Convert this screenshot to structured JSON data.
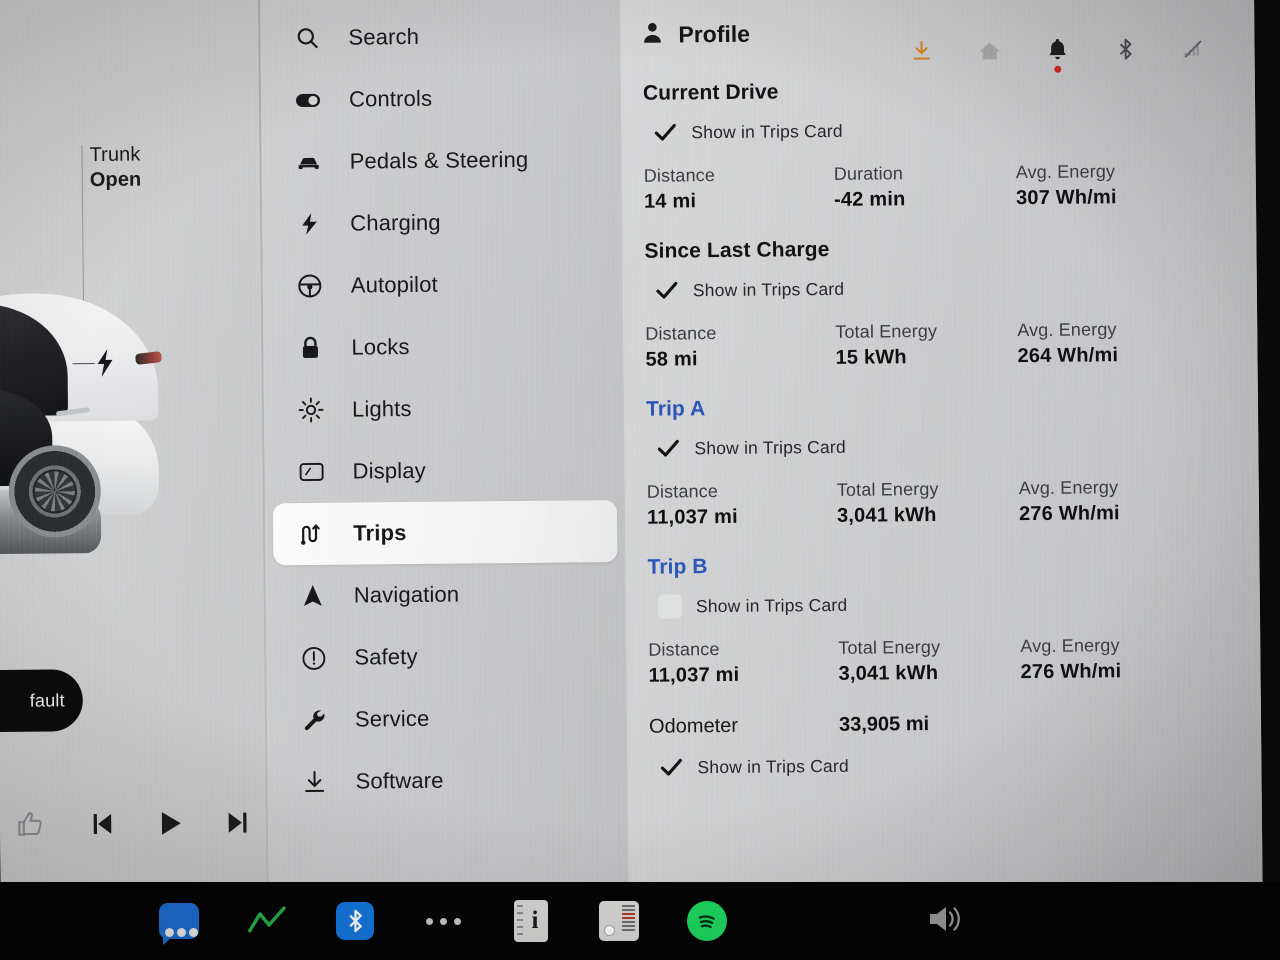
{
  "car_panel": {
    "callout_line1": "Trunk",
    "callout_line2": "Open",
    "fault_pill_label": "fault",
    "media_controls": [
      {
        "name": "thumbs-up-icon",
        "label": "Like"
      },
      {
        "name": "previous-track-icon",
        "label": "Previous"
      },
      {
        "name": "play-icon",
        "label": "Play"
      },
      {
        "name": "next-track-icon",
        "label": "Next"
      }
    ]
  },
  "sidebar": {
    "items": [
      {
        "label": "Search",
        "icon": "search-icon",
        "selected": false
      },
      {
        "label": "Controls",
        "icon": "toggle-icon",
        "selected": false
      },
      {
        "label": "Pedals & Steering",
        "icon": "car-icon",
        "selected": false
      },
      {
        "label": "Charging",
        "icon": "bolt-icon",
        "selected": false
      },
      {
        "label": "Autopilot",
        "icon": "steering-icon",
        "selected": false
      },
      {
        "label": "Locks",
        "icon": "lock-icon",
        "selected": false
      },
      {
        "label": "Lights",
        "icon": "light-icon",
        "selected": false
      },
      {
        "label": "Display",
        "icon": "display-icon",
        "selected": false
      },
      {
        "label": "Trips",
        "icon": "route-icon",
        "selected": true
      },
      {
        "label": "Navigation",
        "icon": "arrow-up-icon",
        "selected": false
      },
      {
        "label": "Safety",
        "icon": "warning-icon",
        "selected": false
      },
      {
        "label": "Service",
        "icon": "wrench-icon",
        "selected": false
      },
      {
        "label": "Software",
        "icon": "download-icon",
        "selected": false
      }
    ]
  },
  "header": {
    "profile_label": "Profile",
    "status_icons": [
      {
        "name": "software-update-icon",
        "color": "#d98324",
        "badge": false
      },
      {
        "name": "home-icon",
        "color": "#a8a9ab",
        "badge": false
      },
      {
        "name": "notification-bell-icon",
        "color": "#1d1e20",
        "badge": true,
        "badge_color": "#cf2b1f"
      },
      {
        "name": "bluetooth-icon",
        "color": "#4a4c4f",
        "badge": false
      },
      {
        "name": "cellular-off-icon",
        "color": "#85878a",
        "badge": false
      }
    ]
  },
  "checkbox_label": "Show in Trips Card",
  "columns": {
    "distance": "Distance",
    "duration": "Duration",
    "total_energy": "Total Energy",
    "avg_energy": "Avg. Energy"
  },
  "sections": [
    {
      "title": "Current Drive",
      "title_style": "heading",
      "checked": true,
      "metrics": [
        {
          "key": "Distance",
          "value": "14 mi"
        },
        {
          "key": "Duration",
          "value": "-42 min"
        },
        {
          "key": "Avg. Energy",
          "value": "307 Wh/mi"
        }
      ]
    },
    {
      "title": "Since Last Charge",
      "title_style": "heading",
      "checked": true,
      "metrics": [
        {
          "key": "Distance",
          "value": "58 mi"
        },
        {
          "key": "Total Energy",
          "value": "15 kWh"
        },
        {
          "key": "Avg. Energy",
          "value": "264 Wh/mi"
        }
      ]
    },
    {
      "title": "Trip A",
      "title_style": "link",
      "checked": true,
      "metrics": [
        {
          "key": "Distance",
          "value": "11,037 mi"
        },
        {
          "key": "Total Energy",
          "value": "3,041 kWh"
        },
        {
          "key": "Avg. Energy",
          "value": "276 Wh/mi"
        }
      ]
    },
    {
      "title": "Trip B",
      "title_style": "link",
      "checked": false,
      "metrics": [
        {
          "key": "Distance",
          "value": "11,037 mi"
        },
        {
          "key": "Total Energy",
          "value": "3,041 kWh"
        },
        {
          "key": "Avg. Energy",
          "value": "276 Wh/mi"
        }
      ]
    }
  ],
  "odometer": {
    "label": "Odometer",
    "value": "33,905 mi",
    "checked": true
  },
  "taskbar": {
    "apps": [
      {
        "name": "messages-app-icon",
        "color": "#1f6fd6"
      },
      {
        "name": "stocks-app-icon",
        "color": "#27b24a"
      },
      {
        "name": "bluetooth-app-icon",
        "color": "#1478e0"
      },
      {
        "name": "more-apps-icon",
        "color": "#c9c9c9"
      },
      {
        "name": "info-app-icon",
        "color": "#d6d6d4"
      },
      {
        "name": "tuner-app-icon",
        "color": "#d8d8d6"
      },
      {
        "name": "spotify-app-icon",
        "color": "#1ed760"
      }
    ],
    "volume_icon": "volume-icon"
  },
  "colors": {
    "accent_link": "#2a55b8",
    "update_orange": "#d98324",
    "notification_red": "#cf2b1f",
    "panel_bg": "#c9cacb",
    "taskbar_bg": "#050506"
  }
}
